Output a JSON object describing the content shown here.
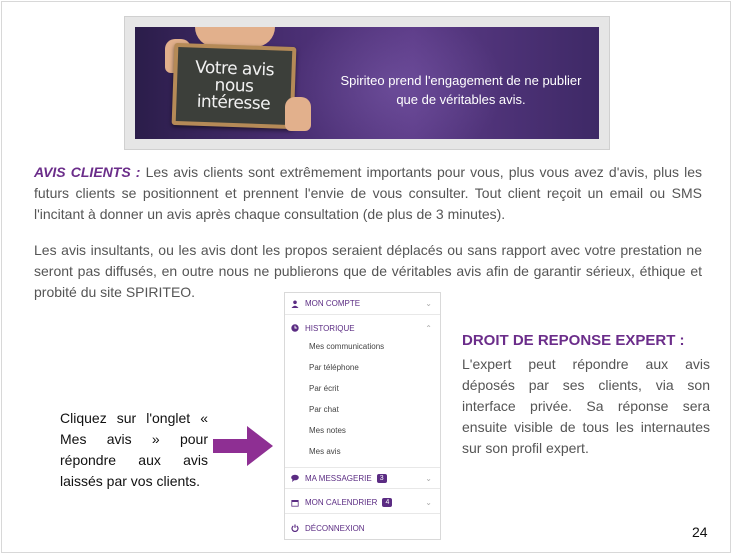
{
  "banner": {
    "board_line1": "Votre avis",
    "board_line2": "nous",
    "board_line3": "intéresse",
    "caption": "Spiriteo prend  l'engagement de ne publier que de véritables avis."
  },
  "paragraph1": {
    "title": "AVIS CLIENTS :",
    "text": " Les avis clients sont extrêmement importants pour vous, plus vous avez d'avis, plus les futurs clients se positionnent et prennent l'envie de vous consulter. Tout client reçoit un email ou SMS l'incitant à donner un avis après chaque consultation (de plus de 3 minutes)."
  },
  "paragraph2": {
    "text": "Les avis insultants, ou les avis dont les propos seraient déplacés ou sans rapport avec votre prestation ne seront pas diffusés, en outre nous ne publierons que de véritables avis afin de garantir sérieux, éthique et probité du site SPIRITEO."
  },
  "menu": {
    "mon_compte": "MON COMPTE",
    "historique": "HISTORIQUE",
    "sub_items": [
      "Mes communications",
      "Par téléphone",
      "Par écrit",
      "Par chat",
      "Mes notes",
      "Mes avis"
    ],
    "messagerie": "MA MESSAGERIE",
    "messagerie_badge": "3",
    "calendrier": "MON CALENDRIER",
    "calendrier_badge": "4",
    "deconnexion": "DÉCONNEXION",
    "accent_color": "#5b2c83"
  },
  "droit": {
    "title": "DROIT DE REPONSE EXPERT :",
    "text": "L'expert peut répondre aux avis déposés par ses clients, via son interface privée. Sa réponse sera ensuite visible de tous les internautes sur son profil expert."
  },
  "instruction": {
    "text": "Cliquez sur l'onglet « Mes avis » pour répondre aux avis laissés par vos clients."
  },
  "arrow_color": "#8e2f93",
  "page_number": "24"
}
